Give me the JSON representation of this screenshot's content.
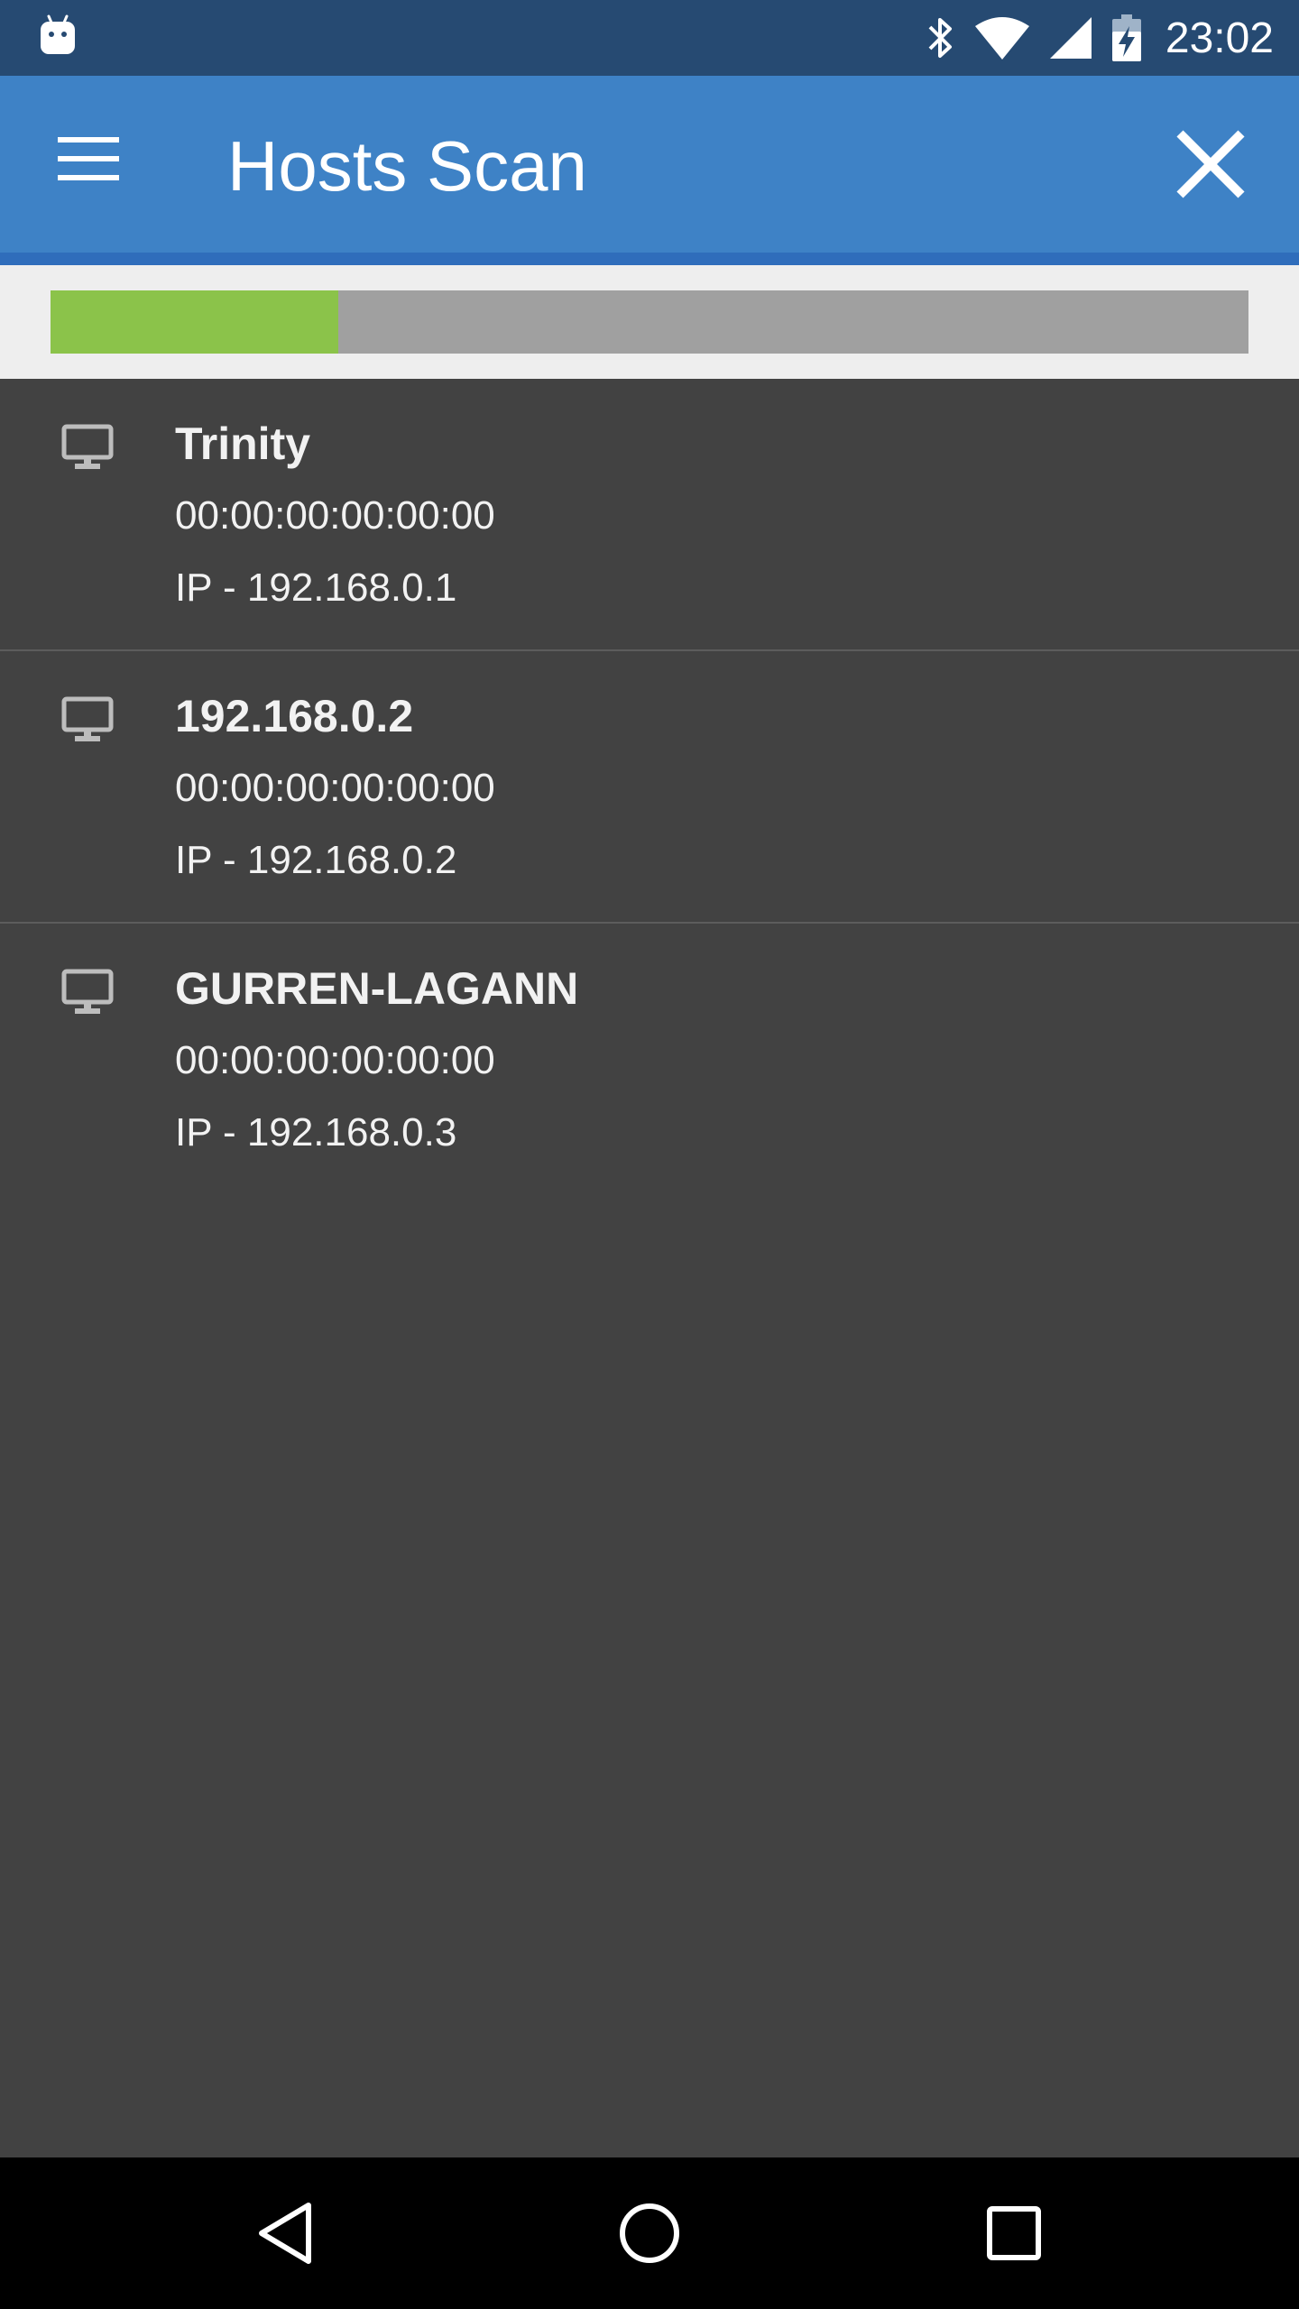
{
  "status_bar": {
    "time": "23:02",
    "icons": [
      "android-notification-icon",
      "bluetooth-icon",
      "wifi-icon",
      "cell-signal-icon",
      "battery-charging-icon"
    ]
  },
  "app_bar": {
    "title": "Hosts Scan",
    "menu_icon": "menu-icon",
    "close_icon": "close-icon",
    "color": "#3e82c6"
  },
  "scan_progress": {
    "fraction": 0.24,
    "fill_color": "#8bc34a",
    "track_color": "#a0a0a0"
  },
  "hosts": [
    {
      "name": "Trinity",
      "mac": "00:00:00:00:00:00",
      "ip": "IP - 192.168.0.1",
      "icon": "desktop-icon"
    },
    {
      "name": "192.168.0.2",
      "mac": "00:00:00:00:00:00",
      "ip": "IP - 192.168.0.2",
      "icon": "desktop-icon"
    },
    {
      "name": "GURREN-LAGANN",
      "mac": "00:00:00:00:00:00",
      "ip": "IP - 192.168.0.3",
      "icon": "desktop-icon"
    }
  ],
  "nav_bar": {
    "buttons": [
      "back-icon",
      "home-icon",
      "recents-icon"
    ]
  }
}
